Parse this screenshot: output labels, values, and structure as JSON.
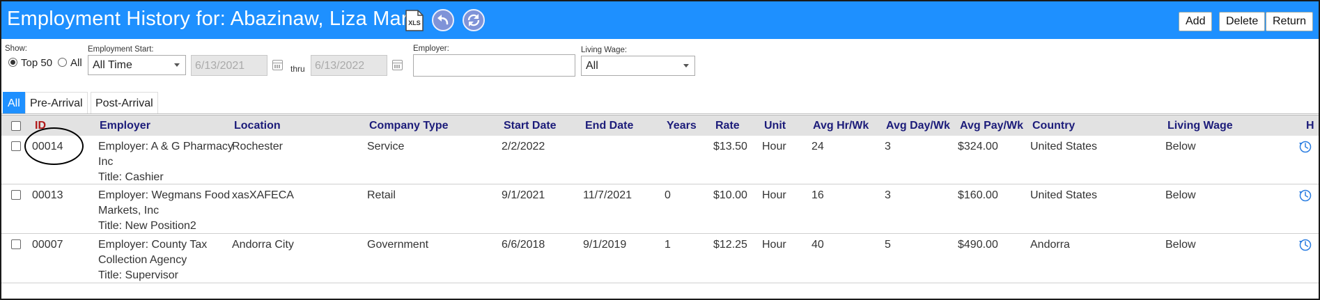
{
  "header": {
    "title": "Employment History for: Abazinaw, Liza Mary",
    "xls_label": "XLS",
    "buttons": {
      "add": "Add",
      "delete": "Delete",
      "return": "Return"
    }
  },
  "filters": {
    "show_label": "Show:",
    "top50_label": "Top 50",
    "all_label": "All",
    "employment_start_label": "Employment Start:",
    "employment_start_value": "All Time",
    "date_from": "6/13/2021",
    "thru_label": "thru",
    "date_to": "6/13/2022",
    "employer_label": "Employer:",
    "employer_value": "",
    "living_wage_label": "Living Wage:",
    "living_wage_value": "All"
  },
  "tabs": [
    {
      "label": "All",
      "active": true
    },
    {
      "label": "Pre-Arrival",
      "active": false
    },
    {
      "label": "Post-Arrival",
      "active": false
    }
  ],
  "table": {
    "columns": [
      "ID",
      "Employer",
      "Location",
      "Company Type",
      "Start Date",
      "End Date",
      "Years",
      "Rate",
      "Unit",
      "Avg Hr/Wk",
      "Avg Day/Wk",
      "Avg Pay/Wk",
      "Country",
      "Living Wage",
      "H"
    ],
    "rows": [
      {
        "id": "00014",
        "employer_line1": "Employer: A & G Pharmacy",
        "employer_line2": "Inc",
        "title": "Title: Cashier",
        "location": "Rochester",
        "company_type": "Service",
        "start_date": "2/2/2022",
        "end_date": "",
        "years": "",
        "rate": "$13.50",
        "unit": "Hour",
        "avg_hr_wk": "24",
        "avg_day_wk": "3",
        "avg_pay_wk": "$324.00",
        "country": "United States",
        "living_wage": "Below"
      },
      {
        "id": "00013",
        "employer_line1": "Employer: Wegmans Food",
        "employer_line2": "Markets, Inc",
        "title": "Title: New Position2",
        "location": "xasXAFECA",
        "company_type": "Retail",
        "start_date": "9/1/2021",
        "end_date": "11/7/2021",
        "years": "0",
        "rate": "$10.00",
        "unit": "Hour",
        "avg_hr_wk": "16",
        "avg_day_wk": "3",
        "avg_pay_wk": "$160.00",
        "country": "United States",
        "living_wage": "Below"
      },
      {
        "id": "00007",
        "employer_line1": "Employer: County Tax",
        "employer_line2": "Collection Agency",
        "title": "Title: Supervisor",
        "location": "Andorra City",
        "company_type": "Government",
        "start_date": "6/6/2018",
        "end_date": "9/1/2019",
        "years": "1",
        "rate": "$12.25",
        "unit": "Hour",
        "avg_hr_wk": "40",
        "avg_day_wk": "5",
        "avg_pay_wk": "$490.00",
        "country": "Andorra",
        "living_wage": "Below"
      }
    ]
  },
  "colors": {
    "header_bg": "#1e90ff",
    "column_header_text": "#1c1c7a",
    "id_header_text": "#b01818"
  }
}
